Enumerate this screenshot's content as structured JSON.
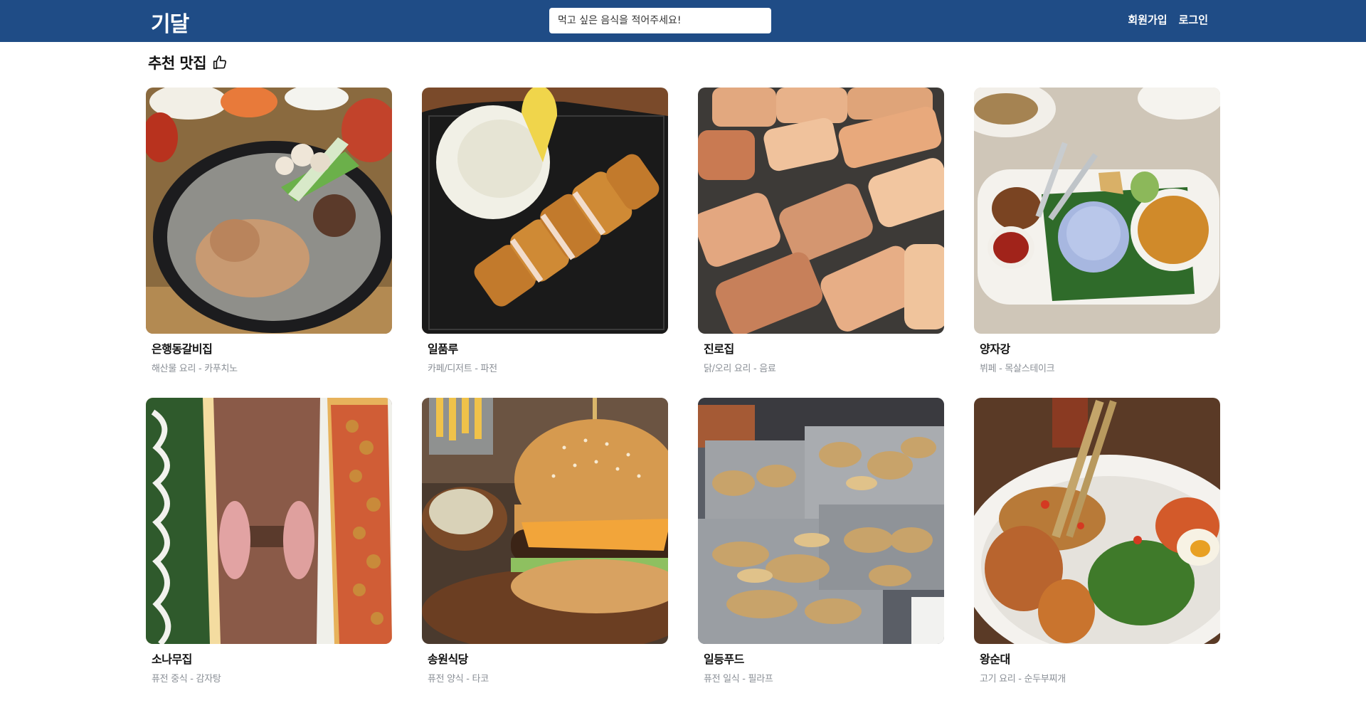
{
  "header": {
    "logo": "기달",
    "search_placeholder": "먹고 싶은 음식을 적어주세요!",
    "signup_label": "회원가입",
    "login_label": "로그인",
    "bg_color": "#1f4c86"
  },
  "section": {
    "title": "추천 맛집",
    "icon": "thumbs-up-icon"
  },
  "restaurants": [
    {
      "name": "은행동갈비집",
      "category": "해산물 요리 - 카푸치노"
    },
    {
      "name": "일품루",
      "category": "카페/디저트 - 파전"
    },
    {
      "name": "진로집",
      "category": "닭/오리 요리 - 음료"
    },
    {
      "name": "양자강",
      "category": "뷔페 - 목살스테이크"
    },
    {
      "name": "소나무집",
      "category": "퓨전 중식 - 감자탕"
    },
    {
      "name": "송원식당",
      "category": "퓨전 양식 - 타코"
    },
    {
      "name": "일등푸드",
      "category": "퓨전 일식 - 필라프"
    },
    {
      "name": "왕순대",
      "category": "고기 요리 - 순두부찌개"
    }
  ]
}
